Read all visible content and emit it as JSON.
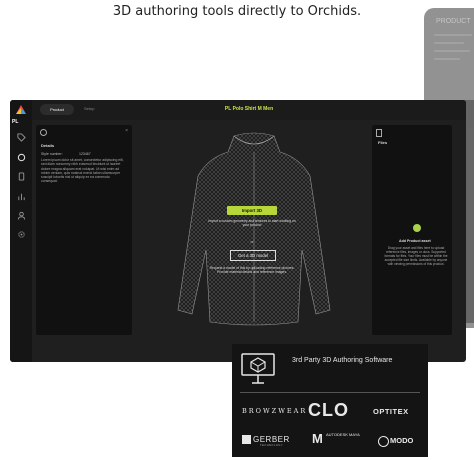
{
  "caption": "3D authoring tools directly to Orchids.",
  "background_window": {
    "title": "PRODUCT"
  },
  "sidebar": {
    "org": "PL"
  },
  "topbar": {
    "tab_active": "Product",
    "tab_other": "Setup",
    "title": "PL Polo Shirt M Men"
  },
  "details_panel": {
    "title": "Details",
    "style_label": "Style number:",
    "style_value": "123467",
    "description": "Lorem ipsum dolor sit amet, consectetur adipiscing elit, sed diam nonummy nibh euismod tincidunt ut laoreet dolore magna aliquam erat volutpat. Ut wisi enim ad minim veniam, quis nostrud exerci tation ullamcorper suscipit lobortis nisl ut aliquip ex ea commodo consequat."
  },
  "files_panel": {
    "title": "Files",
    "add_title": "Add Product asset",
    "add_text": "Drag your asset and files here to upload reference files, images or docs. Supported formats for files. Your files must be within the accepted file size limits. Available by anyone with viewing permissions of this product."
  },
  "center": {
    "import_button": "Import 3D",
    "import_text": "Import a custom geometry and textures to start working on your product",
    "or_text": "or",
    "get_button": "Get a 3D model",
    "request_text": "Request a model of this by uploading reference pictures. Provide material details and reference images."
  },
  "partner_card": {
    "title": "3rd Party 3D Authoring Software",
    "brands": {
      "browzwear": "BROWZWEAR",
      "clo": "CLO",
      "optitex": "OPTITEX",
      "gerber": "GERBER",
      "gerber_sub": "TECHNOLOGY",
      "autodesk_m": "M",
      "autodesk": "AUTODESK MAYA",
      "modo": "MODO"
    }
  },
  "colors": {
    "accent": "#b6d63a",
    "title_green": "#c8e64b",
    "window_bg": "#1f1f1f",
    "panel_bg": "#111111"
  },
  "icons": [
    "logo-icon",
    "tag-icon",
    "sliders-icon",
    "thread-icon",
    "phone-icon",
    "chart-icon",
    "user-icon",
    "settings-icon",
    "computer-icon",
    "close-icon"
  ]
}
